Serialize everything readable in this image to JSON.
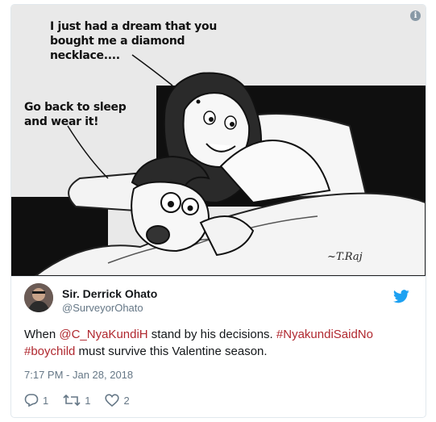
{
  "image": {
    "caption_top": "I just had a dream that you bought me a diamond necklace....",
    "caption_left": "Go back to sleep and wear it!",
    "signature": "~T.Raj"
  },
  "tweet": {
    "display_name": "Sir. Derrick Ohato",
    "handle": "@SurveyorOhato",
    "text_prefix": "When ",
    "mention": "@C_NyaKundiH",
    "text_middle": " stand by his decisions. ",
    "hashtag1": "#NyakundiSaidNo",
    "hashtag2": "#boychild",
    "text_suffix": " must survive this Valentine season.",
    "timestamp": "7:17 PM - Jan 28, 2018",
    "replies": "1",
    "retweets": "1",
    "likes": "2"
  },
  "colors": {
    "link": "#b0282f",
    "twitter_blue": "#1da1f2",
    "muted": "#657786"
  },
  "icons": [
    "info-icon",
    "twitter-bird-icon",
    "reply-icon",
    "retweet-icon",
    "like-icon"
  ]
}
